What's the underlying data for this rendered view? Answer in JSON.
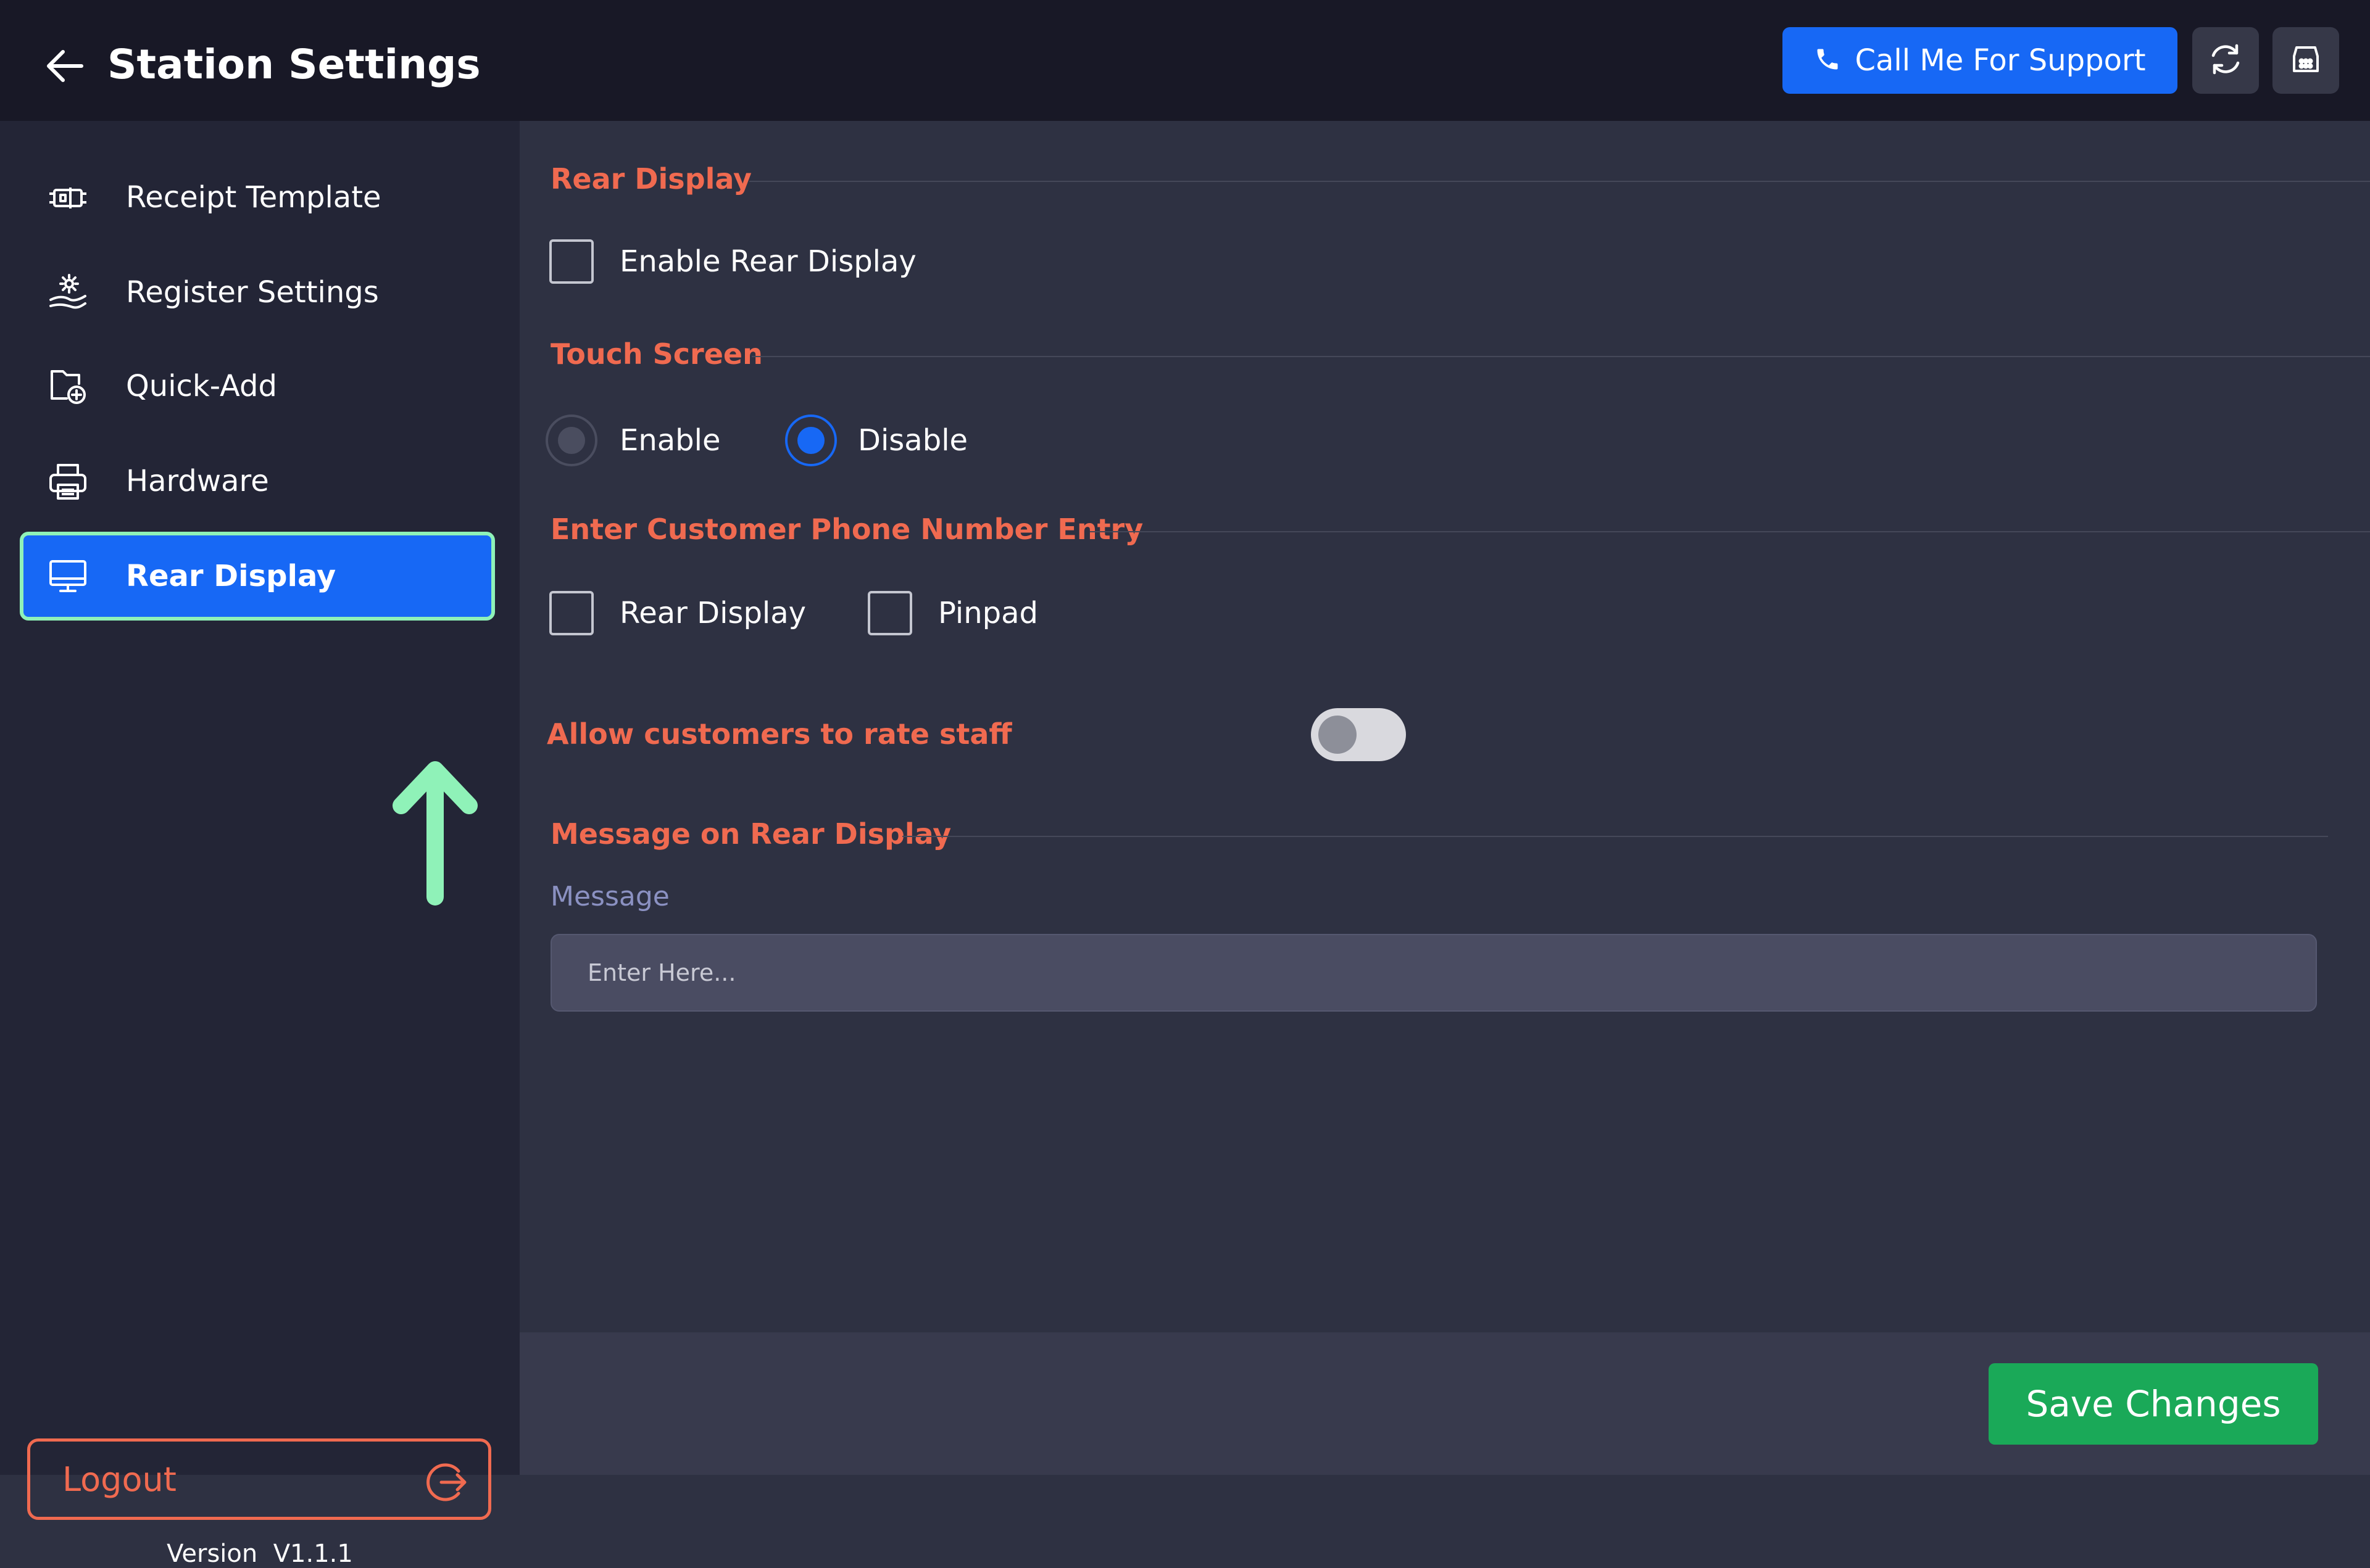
{
  "header": {
    "title": "Station Settings",
    "support_label": "Call Me For Support"
  },
  "sidebar": {
    "items": [
      {
        "label": "Receipt Template",
        "icon": "receipt-template-icon"
      },
      {
        "label": "Register Settings",
        "icon": "register-settings-icon"
      },
      {
        "label": "Quick-Add",
        "icon": "folder-add-icon"
      },
      {
        "label": "Hardware",
        "icon": "printer-icon"
      },
      {
        "label": "Rear Display",
        "icon": "monitor-icon",
        "active": true
      }
    ],
    "logout_label": "Logout",
    "version_label": "Version",
    "version_value": "V1.1.1"
  },
  "main": {
    "rear_display": {
      "title": "Rear Display",
      "enable_label": "Enable Rear Display",
      "enable_checked": false
    },
    "touch_screen": {
      "title": "Touch Screen",
      "options": [
        {
          "label": "Enable",
          "selected": false
        },
        {
          "label": "Disable",
          "selected": true
        }
      ]
    },
    "phone_entry": {
      "title": "Enter Customer Phone Number Entry",
      "options": [
        {
          "label": "Rear Display",
          "checked": false
        },
        {
          "label": "Pinpad",
          "checked": false
        }
      ]
    },
    "rate_staff": {
      "label": "Allow customers to rate staff",
      "enabled": false
    },
    "message": {
      "title": "Message on Rear Display",
      "field_label": "Message",
      "placeholder": "Enter Here...",
      "value": ""
    },
    "save_label": "Save Changes"
  },
  "colors": {
    "accent": "#1768f5",
    "section_title": "#f06a50",
    "save": "#1aa958",
    "active_outline": "#8ff2b8",
    "header_bg": "#181826",
    "sidebar_bg": "#232536",
    "main_bg": "#2e3142"
  }
}
